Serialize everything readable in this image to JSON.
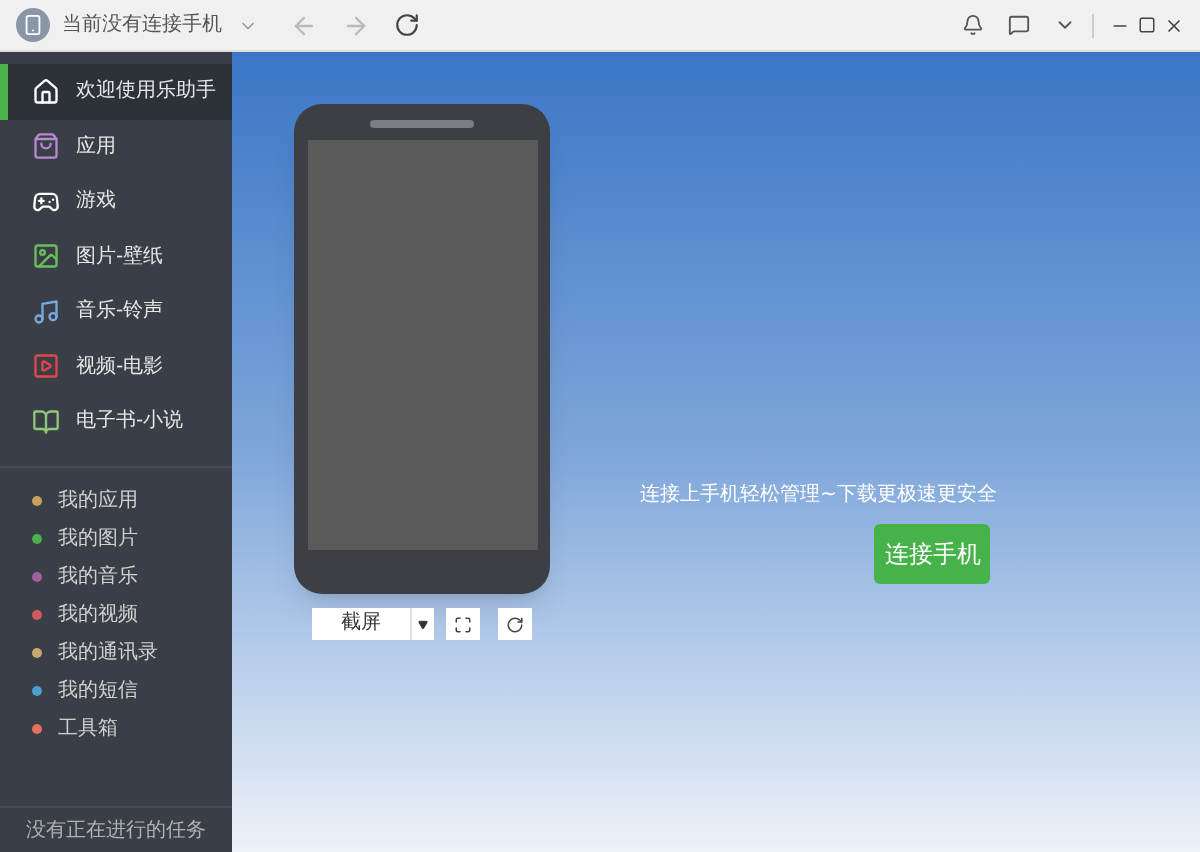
{
  "title_bar": {
    "device_label": "当前没有连接手机"
  },
  "sidebar": {
    "nav_items": [
      {
        "label": "欢迎使用乐助手",
        "selected": true
      },
      {
        "label": "应用",
        "selected": false
      },
      {
        "label": "游戏",
        "selected": false
      },
      {
        "label": "图片-壁纸",
        "selected": false
      },
      {
        "label": "音乐-铃声",
        "selected": false
      },
      {
        "label": "视频-电影",
        "selected": false
      },
      {
        "label": "电子书-小说",
        "selected": false
      }
    ],
    "my_items": [
      {
        "label": "我的应用",
        "color": "#c8a060"
      },
      {
        "label": "我的图片",
        "color": "#4caf50"
      },
      {
        "label": "我的音乐",
        "color": "#a0609c"
      },
      {
        "label": "我的视频",
        "color": "#d05a5a"
      },
      {
        "label": "我的通讯录",
        "color": "#c8a870"
      },
      {
        "label": "我的短信",
        "color": "#4a9fd0"
      },
      {
        "label": "工具箱",
        "color": "#e07060"
      }
    ],
    "status": "没有正在进行的任务"
  },
  "main": {
    "screenshot_button": "截屏",
    "tagline": "连接上手机轻松管理~下载更极速更安全",
    "connect_button": "连接手机"
  }
}
